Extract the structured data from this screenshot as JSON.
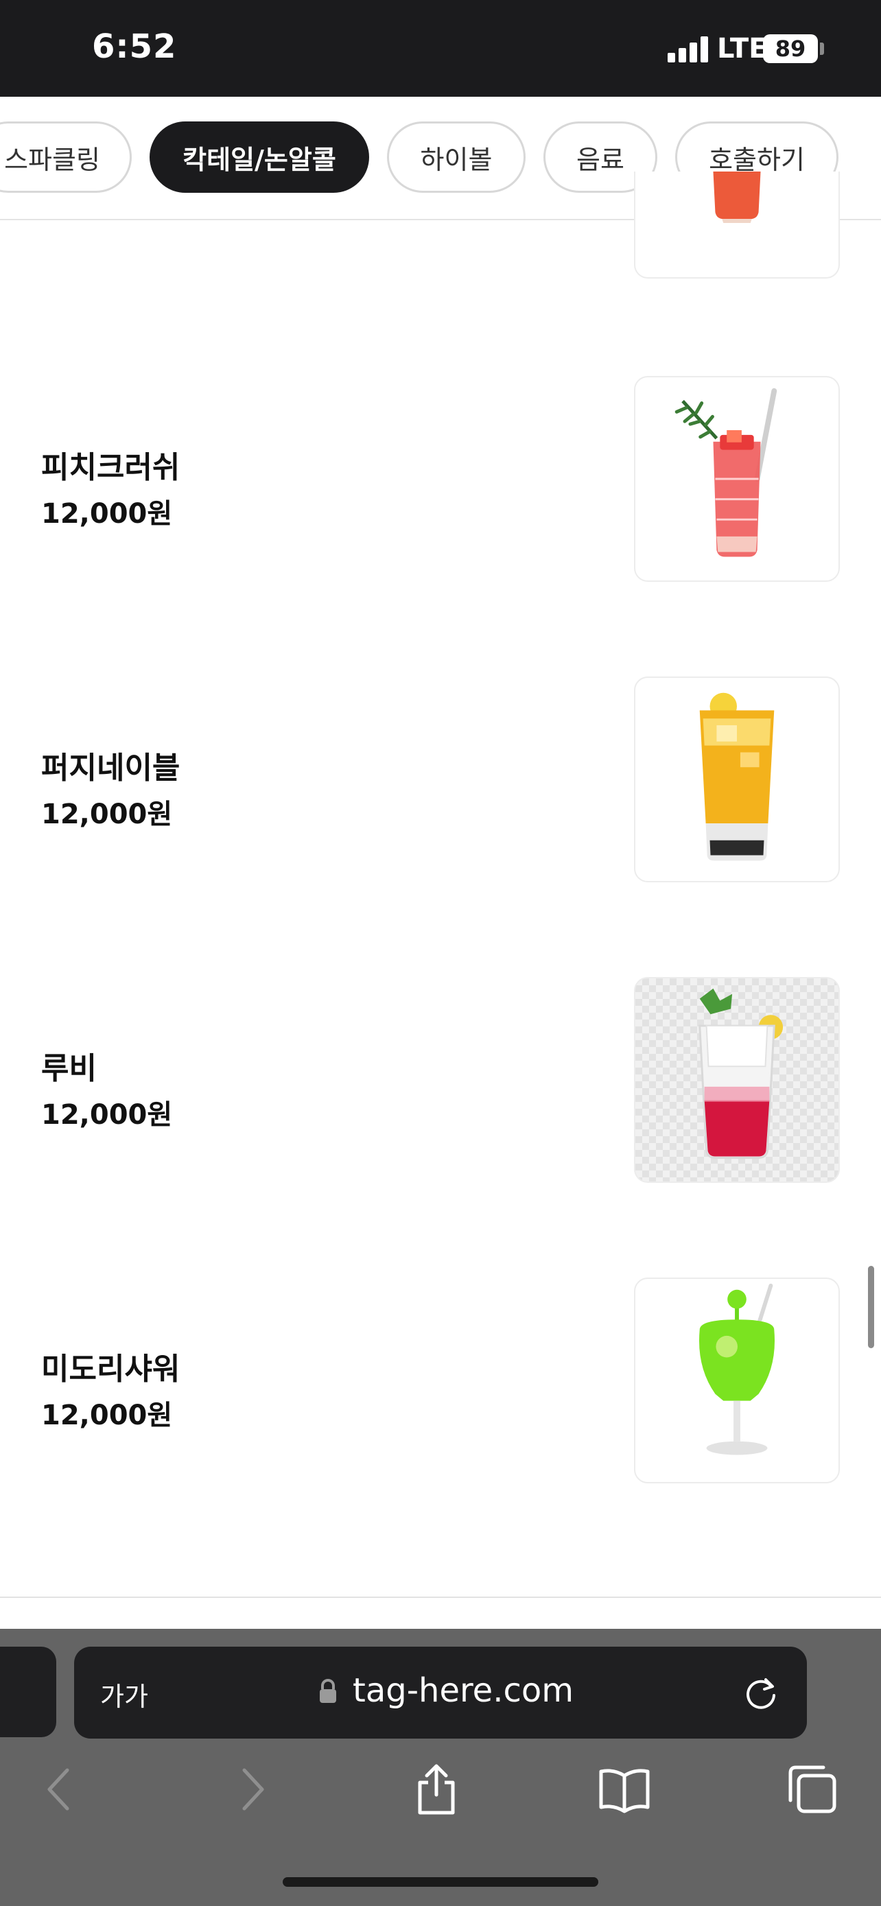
{
  "status_bar": {
    "time": "6:52",
    "network": "LTE",
    "battery": "89"
  },
  "tabs": [
    {
      "label": "스파클링",
      "active": false
    },
    {
      "label": "칵테일/논알콜",
      "active": true
    },
    {
      "label": "하이볼",
      "active": false
    },
    {
      "label": "음료",
      "active": false
    },
    {
      "label": "호출하기",
      "active": false
    }
  ],
  "menu": {
    "items": [
      {
        "name": "피치크러쉬",
        "price": "12,000원"
      },
      {
        "name": "퍼지네이블",
        "price": "12,000원"
      },
      {
        "name": "루비",
        "price": "12,000원"
      },
      {
        "name": "미도리샤워",
        "price": "12,000원"
      }
    ]
  },
  "browser": {
    "text_size_label": "가가",
    "url": "tag-here.com"
  },
  "icons": [
    "lock-icon",
    "reload-icon",
    "back-icon",
    "forward-icon",
    "share-icon",
    "bookmarks-icon",
    "tabs-icon"
  ]
}
